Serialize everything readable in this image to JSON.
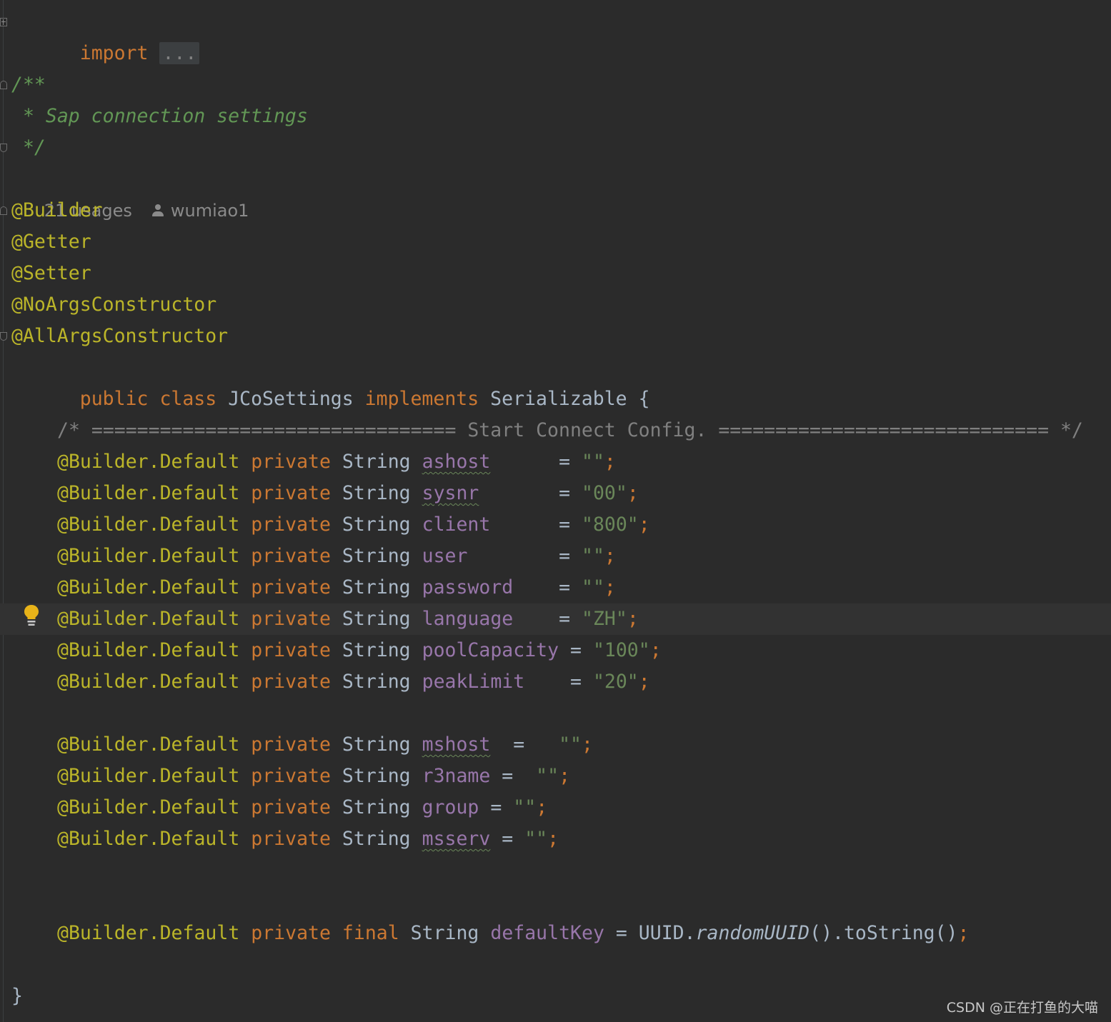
{
  "inlay_hint": {
    "usages": "21 usages",
    "author": "wumiao1"
  },
  "code": {
    "import": {
      "keyword": "import",
      "folded": "..."
    },
    "javadoc": {
      "open": "/**",
      "text": " * Sap connection settings",
      "close": " */"
    },
    "annotations": [
      "@Builder",
      "@Getter",
      "@Setter",
      "@NoArgsConstructor",
      "@AllArgsConstructor"
    ],
    "class_decl": {
      "public": "public",
      "class": "class",
      "name": "JCoSettings",
      "implements": "implements",
      "interface": "Serializable",
      "brace": "{"
    },
    "section_comment": "/* ================================ Start Connect Config. ============================= */",
    "field_prefix": {
      "annotation": "@Builder.Default",
      "private": "private",
      "type": "String"
    },
    "fields_group1": [
      {
        "name": "ashost",
        "pad": "      = ",
        "value": "\"\"",
        "semi": ";"
      },
      {
        "name": "sysnr",
        "pad": "       = ",
        "value": "\"00\"",
        "semi": ";"
      },
      {
        "name": "client",
        "pad": "      = ",
        "value": "\"800\"",
        "semi": ";"
      },
      {
        "name": "user",
        "pad": "        = ",
        "value": "\"\"",
        "semi": ";"
      },
      {
        "name": "password",
        "pad": "    = ",
        "value": "\"\"",
        "semi": ";"
      },
      {
        "name": "language",
        "pad": "    = ",
        "value": "\"ZH\"",
        "semi": ";"
      },
      {
        "name": "poolCapacity",
        "pad": " = ",
        "value": "\"100\"",
        "semi": ";"
      },
      {
        "name": "peakLimit",
        "pad": "    = ",
        "value": "\"20\"",
        "semi": ";"
      }
    ],
    "fields_group2": [
      {
        "name": "mshost",
        "pad": "  =   ",
        "value": "\"\"",
        "semi": ";"
      },
      {
        "name": "r3name",
        "pad": " =  ",
        "value": "\"\"",
        "semi": ";"
      },
      {
        "name": "group",
        "pad": " = ",
        "value": "\"\"",
        "semi": ";"
      },
      {
        "name": "msserv",
        "pad": " = ",
        "value": "\"\"",
        "semi": ";"
      }
    ],
    "default_key": {
      "final": "final",
      "name": "defaultKey",
      "eq": " = ",
      "cls": "UUID.",
      "method": "randomUUID",
      "rest": "().toString()",
      "semi": ";"
    },
    "closing_brace": "}"
  },
  "watermark": "CSDN @正在打鱼的大喵",
  "colors": {
    "background": "#2b2b2b",
    "keyword": "#cc7832",
    "annotation": "#bbb529",
    "field": "#9876aa",
    "string": "#6a8759",
    "doc_comment": "#629755",
    "comment": "#808080",
    "bulb": "#e8b319"
  },
  "icons": [
    "fold-plus-icon",
    "fold-start-icon",
    "fold-end-icon",
    "person-icon",
    "lightbulb-icon"
  ]
}
